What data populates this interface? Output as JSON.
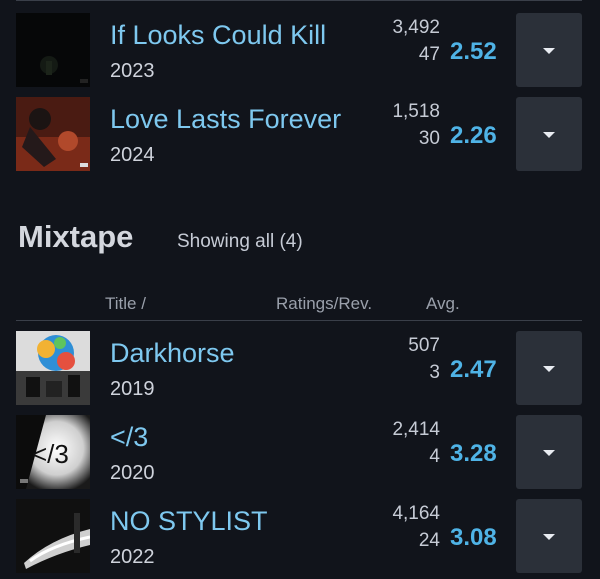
{
  "albums": [
    {
      "title": "If Looks Could Kill",
      "year": "2023",
      "ratings": "3,492",
      "reviews": "47",
      "avg": "2.52"
    },
    {
      "title": "Love Lasts Forever",
      "year": "2024",
      "ratings": "1,518",
      "reviews": "30",
      "avg": "2.26"
    }
  ],
  "mixtape_section": {
    "title": "Mixtape",
    "showing": "Showing all (4)",
    "columns": {
      "title": "Title /",
      "ratings": "Ratings/Rev.",
      "avg": "Avg."
    },
    "items": [
      {
        "title": "Darkhorse",
        "year": "2019",
        "ratings": "507",
        "reviews": "3",
        "avg": "2.47"
      },
      {
        "title": "</3",
        "year": "2020",
        "ratings": "2,414",
        "reviews": "4",
        "avg": "3.28"
      },
      {
        "title": "NO STYLIST",
        "year": "2022",
        "ratings": "4,164",
        "reviews": "24",
        "avg": "3.08"
      }
    ]
  },
  "cover_art": {
    "broken_heart_text": "</3"
  },
  "colors": {
    "background": "#11141b",
    "link": "#7ec8ef",
    "avg": "#4fb3e6",
    "button": "#2b3039"
  },
  "icons": {
    "dropdown": "chevron-down-icon"
  }
}
